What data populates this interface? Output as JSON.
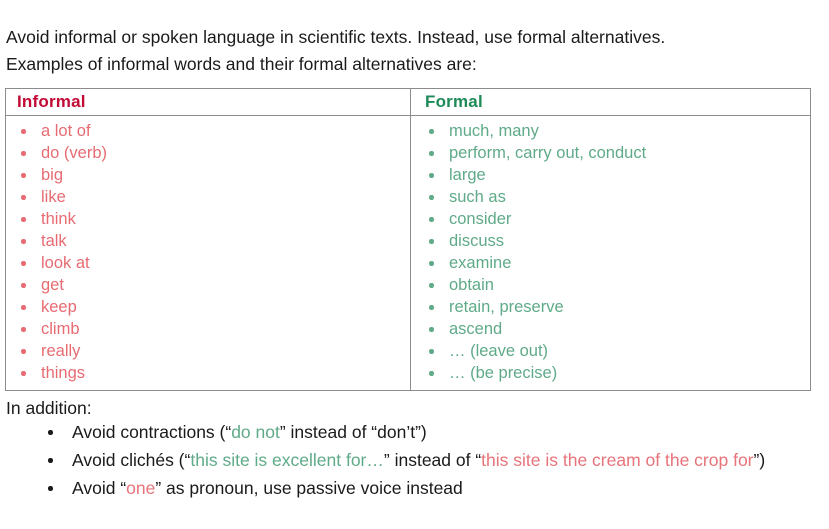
{
  "intro": {
    "text": "Avoid informal or spoken language in scientific texts. Instead, use formal alternatives.\nExamples of informal words and their formal alternatives are:"
  },
  "colors": {
    "informal_header": "#c10b35",
    "informal_items": "#e76b72",
    "formal_header": "#1d8a57",
    "formal_items": "#5faa88",
    "body_text": "#1a1a1a",
    "table_border": "#8c8c8c",
    "page_background": "#ffffff"
  },
  "table": {
    "headers": {
      "informal": "Informal",
      "formal": "Formal"
    },
    "informal_items": [
      "a lot of",
      "do (verb)",
      "big",
      "like",
      "think",
      "talk",
      "look at",
      "get",
      "keep",
      "climb",
      "really",
      "things"
    ],
    "formal_items": [
      "much, many",
      "perform, carry out, conduct",
      "large",
      "such as",
      "consider",
      "discuss",
      "examine",
      "obtain",
      "retain, preserve",
      "ascend",
      "… (leave out)",
      "… (be precise)"
    ]
  },
  "addition": {
    "label": "In addition:",
    "rules": [
      {
        "id": "contractions",
        "parts": [
          {
            "text": "Avoid contractions (“",
            "color": "black"
          },
          {
            "text": "do not",
            "color": "green"
          },
          {
            "text": "” instead of “don’t”)",
            "color": "black"
          }
        ]
      },
      {
        "id": "cliches",
        "parts": [
          {
            "text": "Avoid clichés (“",
            "color": "black"
          },
          {
            "text": "this site is excellent for…",
            "color": "green"
          },
          {
            "text": "” instead of “",
            "color": "black"
          },
          {
            "text": "this site is the cream of the crop for",
            "color": "red"
          },
          {
            "text": "”)",
            "color": "black"
          }
        ]
      },
      {
        "id": "one-pronoun",
        "parts": [
          {
            "text": "Avoid “",
            "color": "black"
          },
          {
            "text": "one",
            "color": "red"
          },
          {
            "text": "” as pronoun, use passive voice instead",
            "color": "black"
          }
        ]
      }
    ]
  }
}
